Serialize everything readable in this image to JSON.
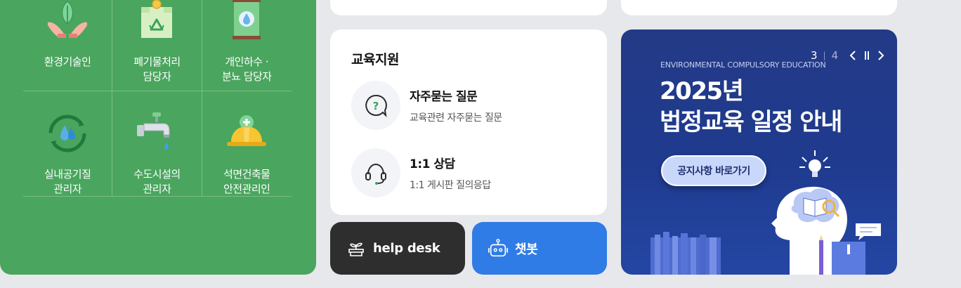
{
  "categories": [
    {
      "label": "환경기술인",
      "icon": "plant-hands-icon"
    },
    {
      "label": "폐기물처리\n담당자",
      "icon": "recycle-bag-icon"
    },
    {
      "label": "개인하수 ·\n분뇨 담당자",
      "icon": "water-tank-icon"
    },
    {
      "label": "실내공기질\n관리자",
      "icon": "air-cycle-icon"
    },
    {
      "label": "수도시설의\n관리자",
      "icon": "faucet-icon"
    },
    {
      "label": "석면건축물\n안전관리인",
      "icon": "safety-helmet-icon"
    }
  ],
  "education": {
    "title": "교육지원",
    "items": [
      {
        "title": "자주묻는 질문",
        "desc": "교육관련 자주묻는 질문",
        "icon": "question-bubble-icon"
      },
      {
        "title": "1:1 상담",
        "desc": "1:1 게시판 질의응답",
        "icon": "headset-icon"
      }
    ]
  },
  "buttons": {
    "help_desk": "help desk",
    "chatbot": "챗봇"
  },
  "banner": {
    "eyebrow": "ENVIRONMENTAL COMPULSORY EDUCATION",
    "title": "2025년\n법정교육 일정 안내",
    "button_label": "공지사항 바로가기",
    "pager_current": "3",
    "pager_total": "4"
  },
  "colors": {
    "green_panel": "#4aa55e",
    "chatbot_blue": "#2f7ce6",
    "helpdesk_dark": "#2e2e2e",
    "banner_navy": "#233a86"
  }
}
